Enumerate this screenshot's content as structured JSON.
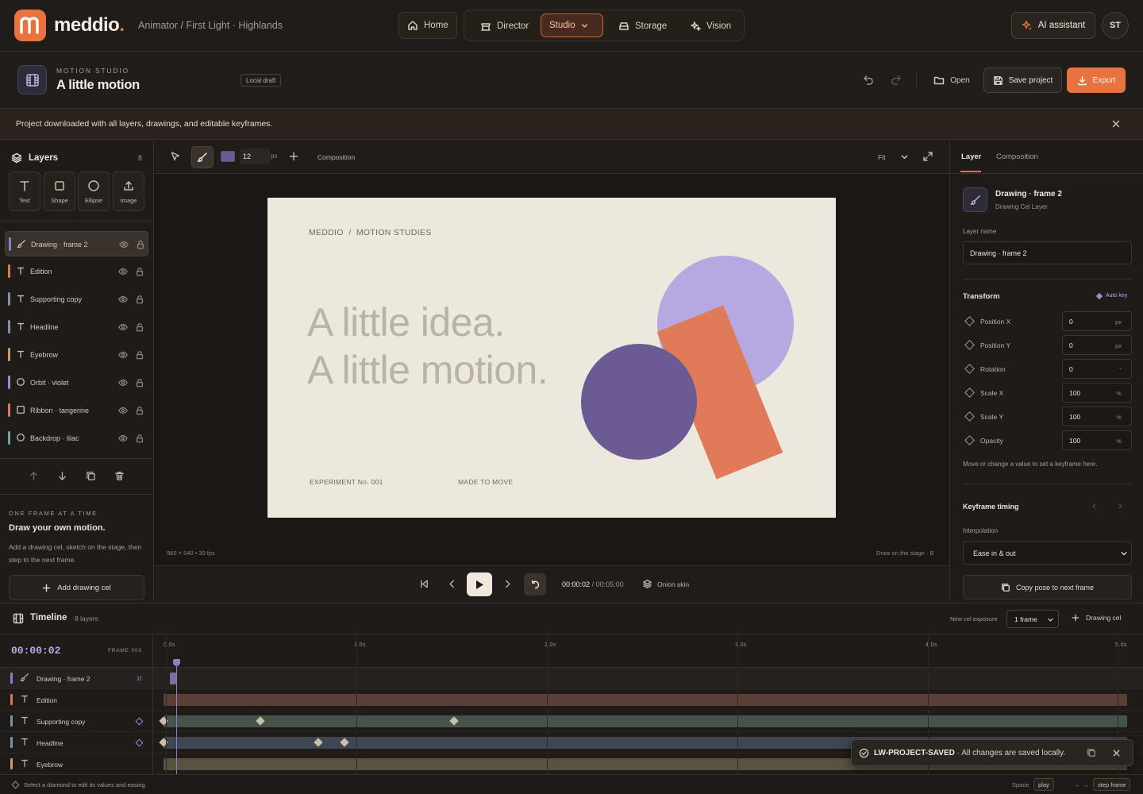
{
  "app": {
    "logo_text": "meddio",
    "logo_dot": ".",
    "breadcrumb": "Animator / First Light · Highlands"
  },
  "nav": {
    "home": "Home",
    "director": "Director",
    "studio": "Studio",
    "storage": "Storage",
    "vision": "Vision"
  },
  "header_right": {
    "ai_label": "AI assistant",
    "avatar_initials": "ST"
  },
  "project": {
    "kicker": "MOTION STUDIO",
    "title": "A little motion",
    "badge": "Local draft",
    "open": "Open",
    "save": "Save project",
    "export": "Export"
  },
  "banner": {
    "message": "Project downloaded with all layers, drawings, and editable keyframes."
  },
  "layers_panel": {
    "title": "Layers",
    "count": "8",
    "tools": [
      {
        "label": "Text"
      },
      {
        "label": "Shape"
      },
      {
        "label": "Ellipse"
      },
      {
        "label": "Image"
      }
    ],
    "items": [
      {
        "name": "Drawing · frame 2",
        "color": "#8a7fc9",
        "icon": "brush-icon"
      },
      {
        "name": "Edition",
        "color": "#d9795a",
        "icon": "text-icon"
      },
      {
        "name": "Supporting copy",
        "color": "#7f93a8",
        "icon": "text-icon"
      },
      {
        "name": "Headline",
        "color": "#7f93a8",
        "icon": "text-icon"
      },
      {
        "name": "Eyebrow",
        "color": "#c9a25a",
        "icon": "text-icon"
      },
      {
        "name": "Orbit · violet",
        "color": "#9b88d6",
        "icon": "ellipse-icon"
      },
      {
        "name": "Ribbon · tangerine",
        "color": "#d9795a",
        "icon": "square-icon"
      },
      {
        "name": "Backdrop · lilac",
        "color": "#6fa3a8",
        "icon": "ellipse-icon"
      }
    ],
    "promo_kicker": "ONE FRAME AT A TIME",
    "promo_title": "Draw your own motion.",
    "promo_desc": "Add a drawing cel, sketch on the stage, then step to the next frame.",
    "add_cel": "Add drawing cel"
  },
  "stage_toolbar": {
    "brush_color": "#6b5a94",
    "brush_size": "12",
    "brush_unit": "px",
    "composition": "Composition",
    "fit": "Fit"
  },
  "canvas": {
    "eyebrow": "MEDDIO  /  MOTION STUDIES",
    "headline_1": "A little idea.",
    "headline_2": "A little motion.",
    "edition": "EXPERIMENT No. 001",
    "supporting": "MADE TO MOVE",
    "bg_color": "#ede8dd",
    "lilac_color": "#b6a8e0",
    "violet_color": "#6b5a94",
    "tangerine_color": "#e07a58"
  },
  "stage_footer": {
    "dimensions": "960 × 540",
    "fps": "30 fps",
    "hint": "Draw on the stage · B"
  },
  "playback": {
    "current": "00:00:02",
    "total": "/ 00:05:00",
    "onion": "Onion skin"
  },
  "inspector": {
    "tab_layer": "Layer",
    "tab_composition": "Composition",
    "layer_title": "Drawing · frame 2",
    "layer_type": "Drawing Cel Layer",
    "name_label": "Layer name",
    "name_value": "Drawing · frame 2",
    "transform_title": "Transform",
    "auto_key": "Auto key",
    "props": [
      {
        "label": "Position X",
        "value": "0",
        "unit": "px"
      },
      {
        "label": "Position Y",
        "value": "0",
        "unit": "px"
      },
      {
        "label": "Rotation",
        "value": "0",
        "unit": "°"
      },
      {
        "label": "Scale X",
        "value": "100",
        "unit": "%"
      },
      {
        "label": "Scale Y",
        "value": "100",
        "unit": "%"
      },
      {
        "label": "Opacity",
        "value": "100",
        "unit": "%"
      }
    ],
    "hint": "Move or change a value to set a keyframe here.",
    "timing_title": "Keyframe timing",
    "interp_label": "Interpolation",
    "interp_value": "Ease in & out",
    "copy_pose": "Copy pose to next frame"
  },
  "timeline": {
    "title": "Timeline",
    "layer_count": "8 layers",
    "exposure_label": "New cel exposure",
    "exposure_value": "1 frame",
    "add_cel": "Drawing cel",
    "timecode": "00:00:02",
    "frame": "FRAME 003",
    "ticks": [
      "0.0s",
      "1.0s",
      "2.0s",
      "3.0s",
      "4.0s",
      "5.0s"
    ],
    "rows": [
      {
        "name": "Drawing · frame 2",
        "color": "#8a7fc9",
        "icon": "brush-icon",
        "badge": "1f"
      },
      {
        "name": "Edition",
        "color": "#d9795a",
        "icon": "text-icon"
      },
      {
        "name": "Supporting copy",
        "color": "#7f93a8",
        "icon": "text-icon"
      },
      {
        "name": "Headline",
        "color": "#7f93a8",
        "icon": "text-icon"
      },
      {
        "name": "Eyebrow",
        "color": "#c9a25a",
        "icon": "text-icon"
      }
    ]
  },
  "toast": {
    "code": "LW-PROJECT-SAVED",
    "message": " · All changes are saved locally."
  },
  "status": {
    "hint": "Select a diamond to edit its values and easing.",
    "space_label": "Space",
    "space_action": "play",
    "arrows": "← →",
    "arrows_action": "step frame"
  }
}
